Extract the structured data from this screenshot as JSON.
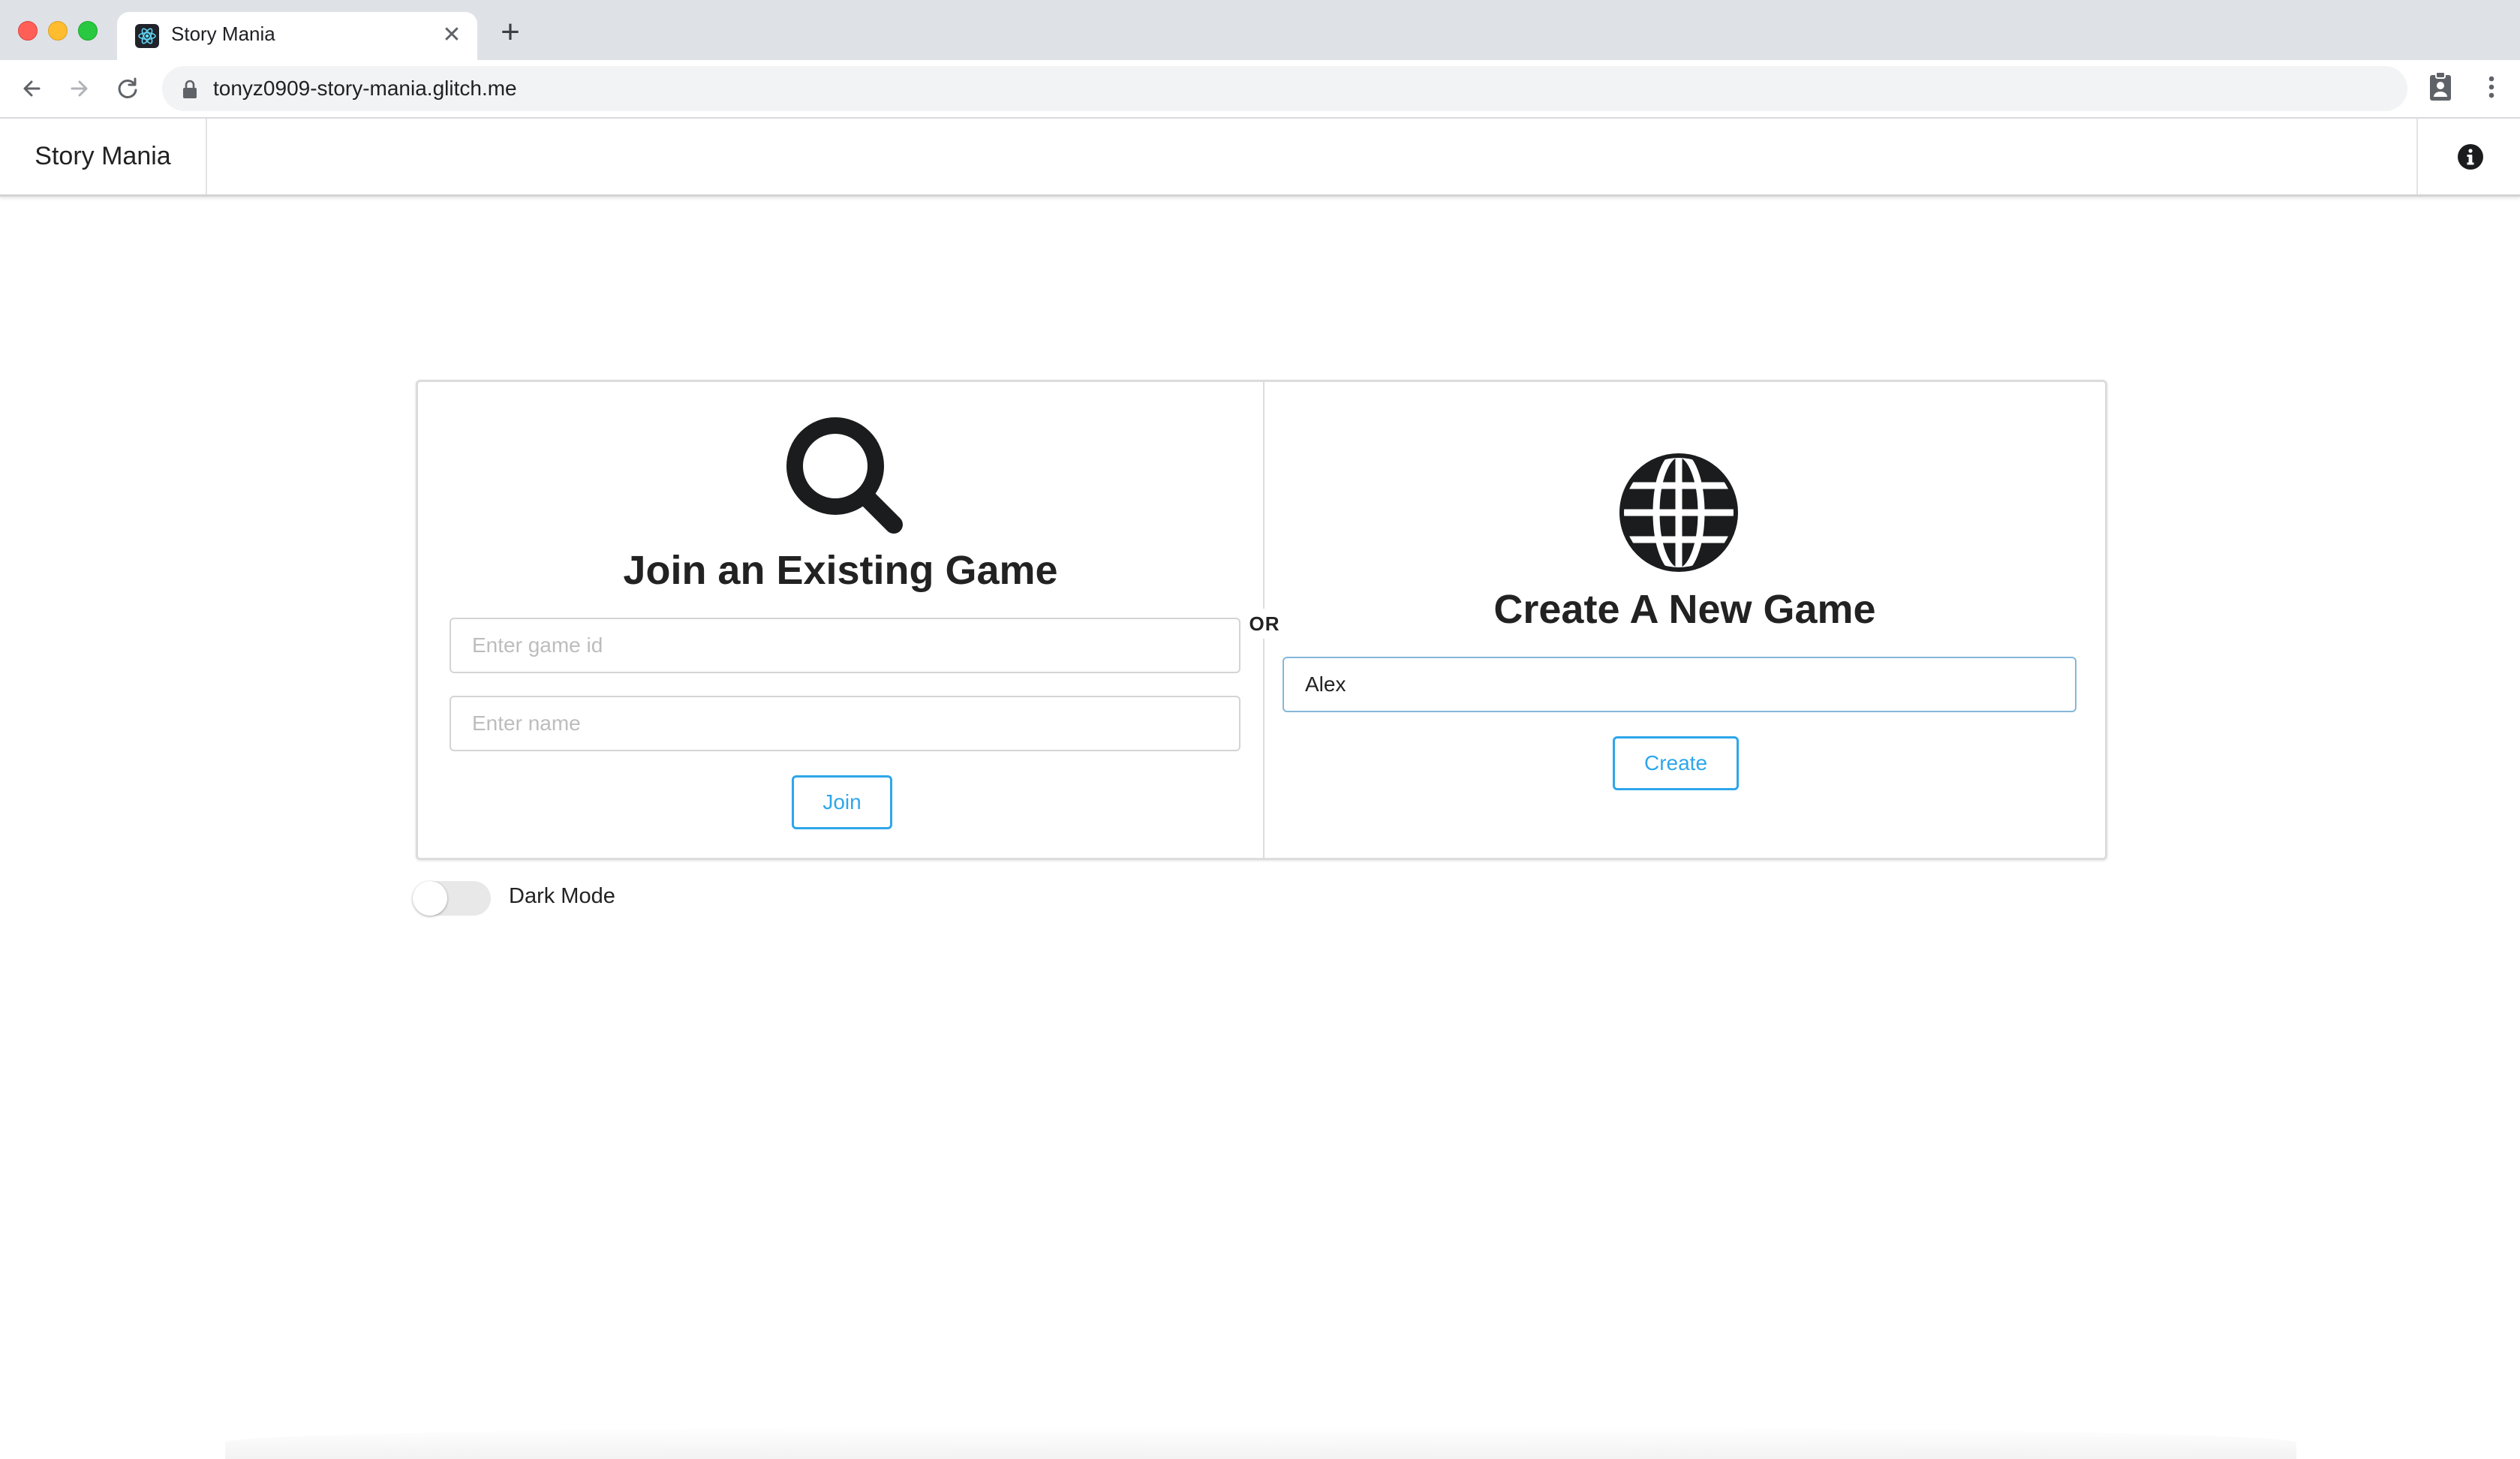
{
  "browser": {
    "tab_title": "Story Mania",
    "tab_close": "✕",
    "new_tab": "+",
    "url": "tonyz0909-story-mania.glitch.me"
  },
  "navbar": {
    "brand": "Story Mania",
    "info_icon": "info-icon"
  },
  "join": {
    "icon": "search-icon",
    "heading": "Join an Existing Game",
    "game_id_placeholder": "Enter game id",
    "name_placeholder": "Enter name",
    "button_label": "Join"
  },
  "separator": "OR",
  "create": {
    "icon": "globe-icon",
    "heading": "Create A New Game",
    "name_value": "Alex",
    "button_label": "Create"
  },
  "dark_mode": {
    "label": "Dark Mode",
    "enabled": false
  },
  "colors": {
    "accent": "#2ea6ea",
    "text": "#222222",
    "border": "#d4d4d5"
  }
}
